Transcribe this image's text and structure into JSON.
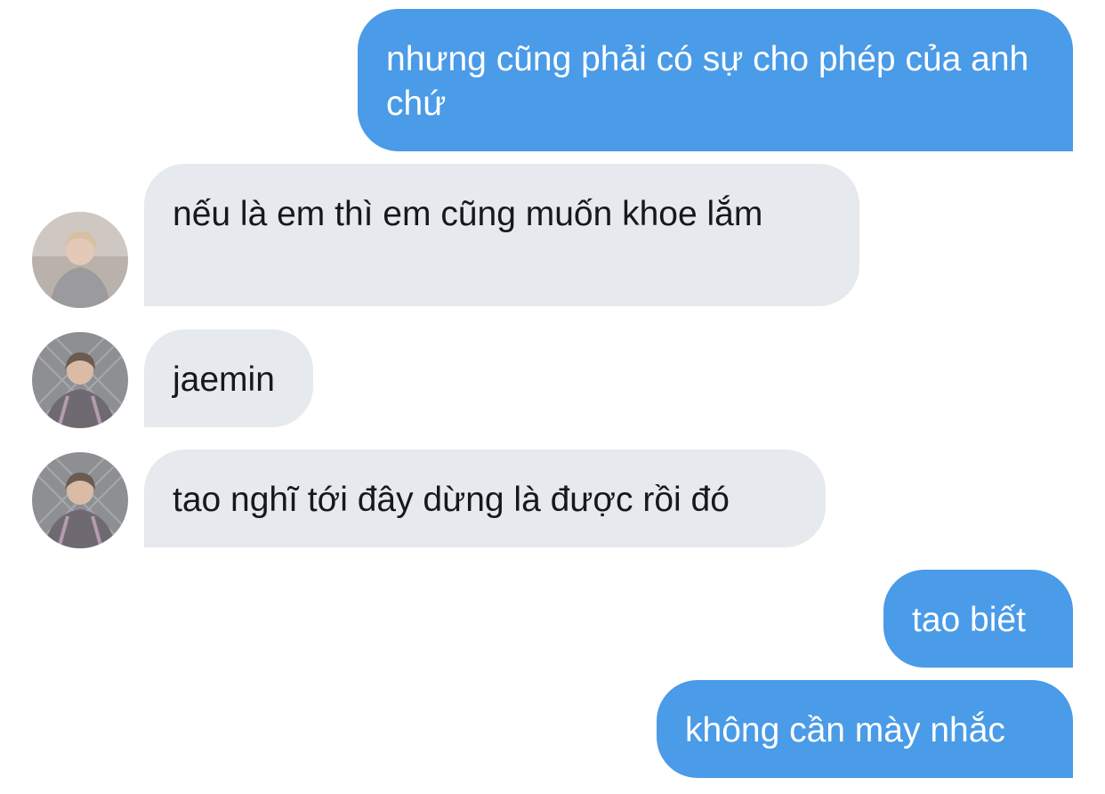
{
  "conversation": {
    "messages": [
      {
        "id": 0,
        "direction": "sent",
        "text": "nhưng cũng phải có sự cho phép của anh chứ"
      },
      {
        "id": 1,
        "direction": "received",
        "text": "nếu là em thì em cũng muốn khoe lắm",
        "avatar_icon": "avatar-user-gray-hoodie"
      },
      {
        "id": 2,
        "direction": "received",
        "text": "jaemin",
        "avatar_icon": "avatar-user-plaid-jacket"
      },
      {
        "id": 3,
        "direction": "received",
        "text": "tao nghĩ tới đây dừng là được rồi đó",
        "avatar_icon": "avatar-user-plaid-jacket"
      },
      {
        "id": 4,
        "direction": "sent",
        "text": "tao biết"
      },
      {
        "id": 5,
        "direction": "sent",
        "text": "không cần mày nhắc"
      }
    ]
  },
  "colors": {
    "sent_bubble": "#4a9be8",
    "received_bubble": "#e6e9ed",
    "sent_text": "#ffffff",
    "received_text": "#16181c",
    "background": "#ffffff"
  }
}
